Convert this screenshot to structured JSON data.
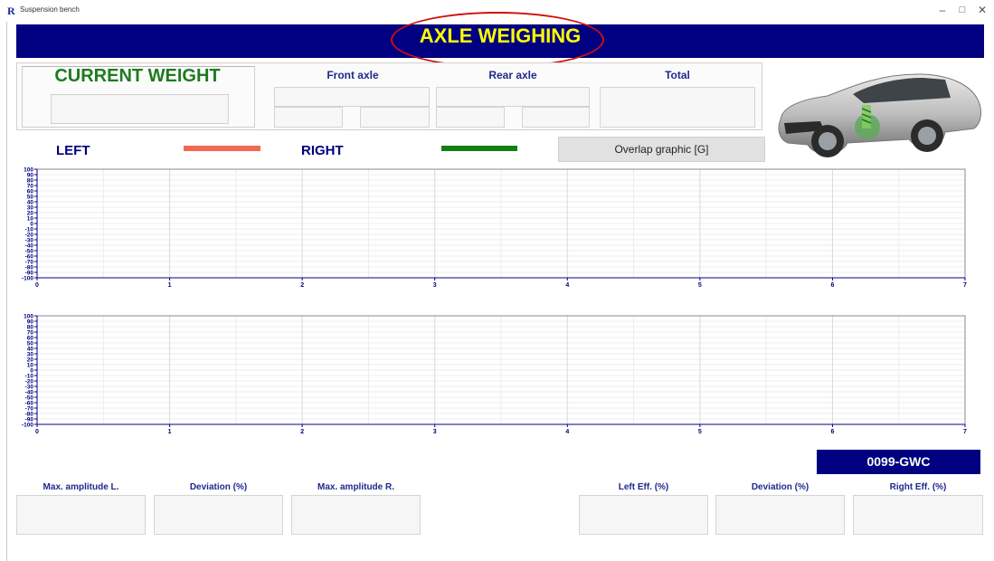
{
  "window": {
    "title": "Suspension bench",
    "icon": "R",
    "controls": [
      "–",
      "□",
      "✕"
    ]
  },
  "header": {
    "title": "AXLE WEIGHING"
  },
  "weight_panel": {
    "current_weight_label": "CURRENT WEIGHT",
    "front_axle_label": "Front axle",
    "rear_axle_label": "Rear axle",
    "total_label": "Total"
  },
  "legend": {
    "left_label": "LEFT",
    "left_color": "#f06a50",
    "right_label": "RIGHT",
    "right_color": "#138013"
  },
  "overlap_button_label": "Overlap graphic [G]",
  "plate": "0099-GWC",
  "stats": {
    "max_amplitude_left": "Max. amplitude L.",
    "deviation_left": "Deviation (%)",
    "max_amplitude_right": "Max. amplitude R.",
    "left_eff": "Left Eff. (%)",
    "deviation_eff": "Deviation (%)",
    "right_eff": "Right Eff. (%)"
  },
  "chart_data": [
    {
      "type": "line",
      "x_ticks": [
        "0",
        "1",
        "2",
        "3",
        "4",
        "5",
        "6",
        "7"
      ],
      "xlim": [
        0,
        7
      ],
      "y_ticks": [
        "100",
        "90",
        "80",
        "70",
        "60",
        "50",
        "40",
        "30",
        "20",
        "10",
        "0",
        "-10",
        "-20",
        "-30",
        "-40",
        "-50",
        "-60",
        "-70",
        "-80",
        "-90",
        "-100"
      ],
      "ylim": [
        -100,
        100
      ],
      "grid": true,
      "series": []
    },
    {
      "type": "line",
      "x_ticks": [
        "0",
        "1",
        "2",
        "3",
        "4",
        "5",
        "6",
        "7"
      ],
      "xlim": [
        0,
        7
      ],
      "y_ticks": [
        "100",
        "90",
        "80",
        "70",
        "60",
        "50",
        "40",
        "30",
        "20",
        "10",
        "0",
        "-10",
        "-20",
        "-30",
        "-40",
        "-50",
        "-60",
        "-70",
        "-80",
        "-90",
        "-100"
      ],
      "ylim": [
        -100,
        100
      ],
      "grid": true,
      "series": []
    }
  ]
}
